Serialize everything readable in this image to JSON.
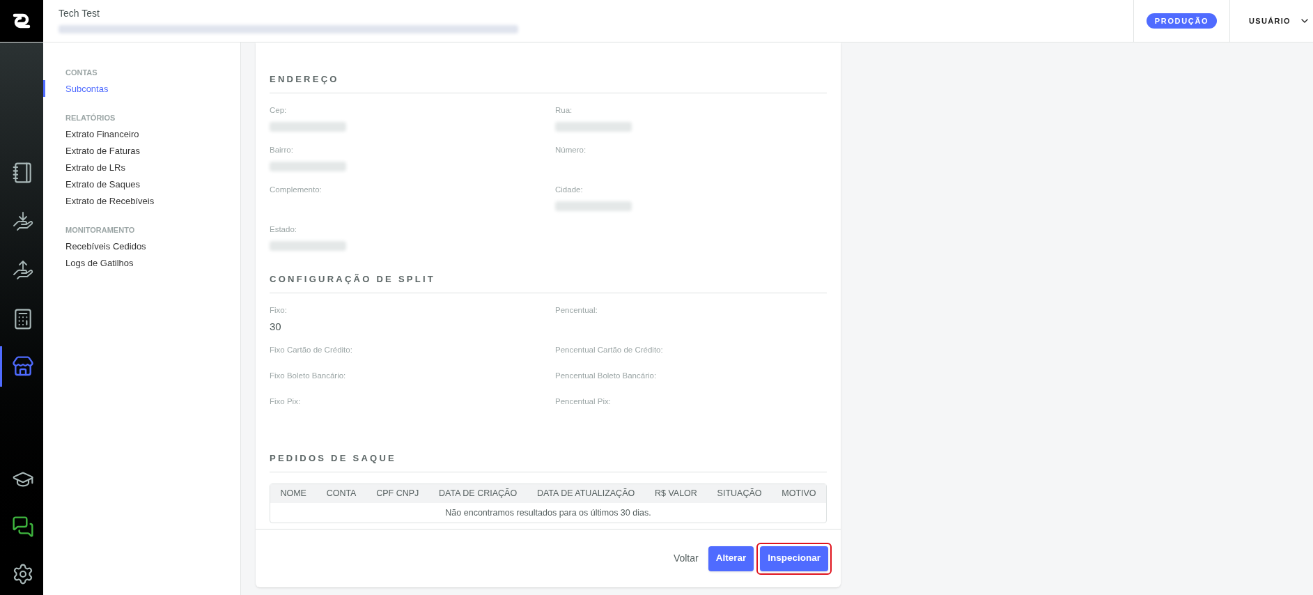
{
  "header": {
    "title": "Tech Test",
    "environment_badge": "PRODUÇÃO",
    "user_menu": "USUÁRIO"
  },
  "rail": [
    {
      "kind": "notebook",
      "selected": false
    },
    {
      "kind": "receive",
      "selected": false
    },
    {
      "kind": "send",
      "selected": false
    },
    {
      "kind": "calculator",
      "selected": false
    },
    {
      "kind": "store",
      "selected": true
    },
    {
      "kind": "learn",
      "selected": false
    },
    {
      "kind": "chat",
      "selected": false
    },
    {
      "kind": "settings",
      "selected": false
    }
  ],
  "sidebar": [
    {
      "heading": "CONTAS",
      "items": [
        {
          "label": "Subcontas",
          "selected": true
        }
      ]
    },
    {
      "heading": "RELATÓRIOS",
      "items": [
        {
          "label": "Extrato Financeiro",
          "selected": false
        },
        {
          "label": "Extrato de Faturas",
          "selected": false
        },
        {
          "label": "Extrato de LRs",
          "selected": false
        },
        {
          "label": "Extrato de Saques",
          "selected": false
        },
        {
          "label": "Extrato de Recebíveis",
          "selected": false
        }
      ]
    },
    {
      "heading": "MONITORAMENTO",
      "items": [
        {
          "label": "Recebíveis Cedidos",
          "selected": false
        },
        {
          "label": "Logs de Gatilhos",
          "selected": false
        }
      ]
    }
  ],
  "sections": [
    {
      "title": "ENDEREÇO",
      "fields": [
        {
          "label": "Cep:",
          "redacted": true
        },
        {
          "label": "Rua:",
          "redacted": true
        },
        {
          "label": "Bairro:",
          "redacted": true
        },
        {
          "label": "Número:",
          "redacted": false
        },
        {
          "label": "Complemento:",
          "redacted": false
        },
        {
          "label": "Cidade:",
          "redacted": true
        },
        {
          "label": "Estado:",
          "redacted": true
        }
      ]
    },
    {
      "title": "CONFIGURAÇÃO DE SPLIT",
      "fields": [
        {
          "label": "Fixo:",
          "value": "30"
        },
        {
          "label": "Pencentual:"
        },
        {
          "label": "Fixo Cartão de Crédito:"
        },
        {
          "label": "Pencentual Cartão de Crédito:"
        },
        {
          "label": "Fixo Boleto Bancário:"
        },
        {
          "label": "Pencentual Boleto Bancário:"
        },
        {
          "label": "Fixo Pix:"
        },
        {
          "label": "Pencentual Pix:"
        }
      ]
    }
  ],
  "withdrawals": {
    "title": "PEDIDOS DE SAQUE",
    "columns": [
      "NOME",
      "CONTA",
      "CPF CNPJ",
      "DATA DE CRIAÇÃO",
      "DATA DE ATUALIZAÇÃO",
      "R$ VALOR",
      "SITUAÇÃO",
      "MOTIVO"
    ],
    "empty_message": "Não encontramos resultados para os últimos 30 dias."
  },
  "actions": [
    {
      "label": "Voltar",
      "kind": "link",
      "highlighted": false
    },
    {
      "label": "Alterar",
      "kind": "primary",
      "highlighted": false
    },
    {
      "label": "Inspecionar",
      "kind": "primary",
      "highlighted": true
    }
  ]
}
